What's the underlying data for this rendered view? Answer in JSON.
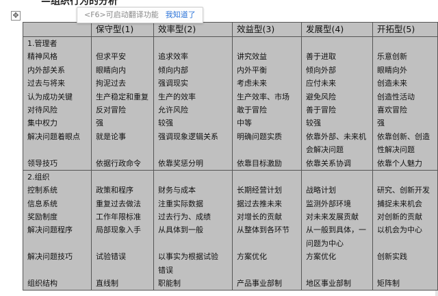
{
  "document": {
    "heading_fragment": "—组织行为的分析",
    "move_handle_glyph": "✥"
  },
  "translate_popup": {
    "hint": "<F6>可启动翻译功能",
    "ack": "我知道了"
  },
  "table": {
    "headers": [
      "",
      "保守型(1)",
      "效率型(2)",
      "效益型(3)",
      "发展型(4)",
      "开拓型(5)"
    ],
    "sections": [
      {
        "columns": [
          [
            "1.管理者",
            "精神风格",
            "内外部关系",
            "过去与将来",
            "认为成功关键",
            "对待风险",
            "集中权力",
            "解决问题着眼点",
            "",
            "领导技巧"
          ],
          [
            "",
            "但求平安",
            "眼睛向内",
            "拘泥过去",
            "生产稳定和重复",
            "反对冒险",
            "强",
            "就是论事",
            "",
            "依据行政命令"
          ],
          [
            "",
            "追求效率",
            "倾向内部",
            "强调现实",
            "生产的效率",
            "允许风险",
            "较强",
            "强调现象逻辑关系",
            "",
            "依靠奖惩分明"
          ],
          [
            "",
            "讲究效益",
            "内外平衡",
            "考虑未来",
            "生产效率、市场",
            "敢于冒险",
            "中等",
            "明确问题实质",
            "",
            "依靠目标激励"
          ],
          [
            "",
            "善于进取",
            "倾向外部",
            "应付未来",
            "避免风险",
            "善于冒险",
            "较强",
            "依靠外部、未来机",
            "会解决问题",
            "依靠关系协调"
          ],
          [
            "",
            "乐意创新",
            "眼睛向外",
            "创造未来",
            "创造性活动",
            "喜欢冒险",
            "强",
            "依靠创新、创造",
            "性解决问题",
            "依靠个人魅力"
          ]
        ]
      },
      {
        "columns": [
          [
            "2.组织",
            "控制系统",
            "信息系统",
            "奖励制度",
            "解决问题程序",
            "",
            "解决问题技巧",
            "",
            "组织结构"
          ],
          [
            "",
            "政策和程序",
            "重复过去做法",
            "工作年限标准",
            "局部现象入手",
            "",
            "试验错误",
            "",
            "直线制"
          ],
          [
            "",
            "财务与成本",
            "注重实际数据",
            "过去行为、成绩",
            "从具体到一般",
            "",
            "以事实为根据试验",
            "错误",
            "职能制"
          ],
          [
            "",
            "长期经营计划",
            "据过去推未来",
            "对增长的贡献",
            "从整体到各环节",
            "",
            "方案优化",
            "",
            "产品事业部制"
          ],
          [
            "",
            "战略计划",
            "监测外部环境",
            "对未来发展贡献",
            "从一般到具体，一",
            "问题为中心",
            "方案优化",
            "",
            "地区事业部制"
          ],
          [
            "",
            "研究、创新开发",
            "捕捉未来机会",
            "对创新的贡献",
            "以机会为中心",
            "",
            "创新实践",
            "",
            "矩阵制"
          ]
        ]
      }
    ]
  }
}
